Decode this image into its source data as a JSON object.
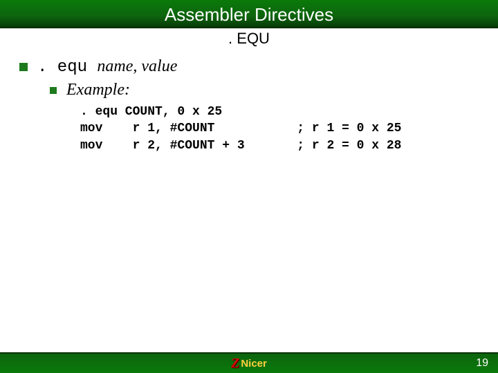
{
  "header": {
    "title": "Assembler Directives",
    "subtitle": ". EQU"
  },
  "bullet1": {
    "directive": ". equ ",
    "args": "name, value"
  },
  "bullet2": {
    "label": "Example:"
  },
  "code": {
    "l1": ". equ COUNT, 0 x 25",
    "l2": "mov    r 1, #COUNT           ; r 1 = 0 x 25",
    "l3": "mov    r 2, #COUNT + 3       ; r 2 = 0 x 28"
  },
  "footer": {
    "logo_z": "Z",
    "logo_text": "Nicer",
    "page": "19"
  }
}
